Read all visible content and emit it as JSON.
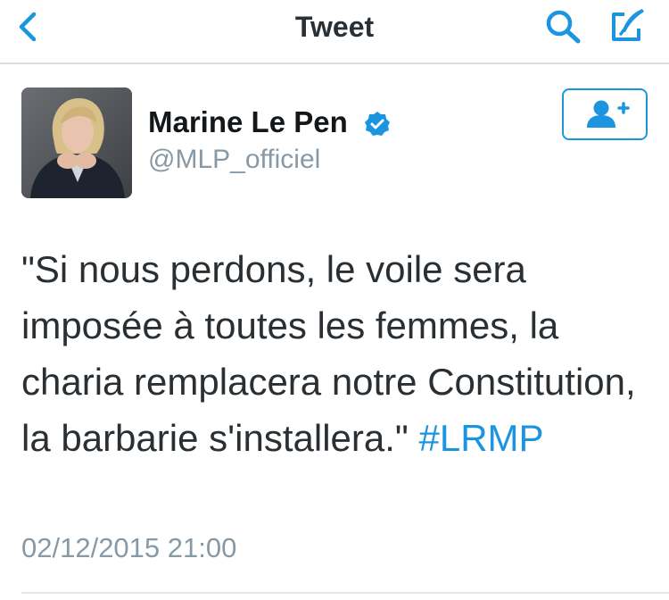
{
  "nav": {
    "title": "Tweet",
    "back_icon": "chevron-left-icon",
    "search_icon": "search-icon",
    "compose_icon": "compose-feather-icon",
    "accent_color": "#1b95e0"
  },
  "author": {
    "display_name": "Marine Le Pen",
    "handle": "@MLP_officiel",
    "verified": true,
    "verified_icon": "verified-badge-icon",
    "avatar_icon": "avatar-photo"
  },
  "follow_button": {
    "icon": "add-user-icon"
  },
  "tweet": {
    "text": "\"Si nous perdons, le voile sera imposée à toutes les femmes, la charia remplacera notre Constitution, la barbarie s'installera.\" ",
    "hashtag": "#LRMP",
    "timestamp": "02/12/2015 21:00"
  },
  "colors": {
    "link": "#1b95e0",
    "muted": "#8899a6",
    "text": "#292f33"
  }
}
